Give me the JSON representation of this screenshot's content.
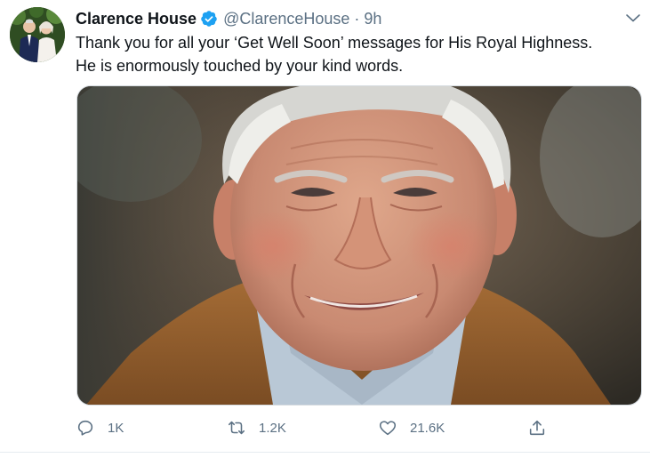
{
  "tweet": {
    "display_name": "Clarence House",
    "handle": "@ClarenceHouse",
    "separator": "·",
    "time": "9h",
    "text_lines": [
      "Thank you for all your ‘Get Well Soon’ messages for His Royal Highness.",
      "He is enormously touched by your kind words."
    ]
  },
  "actions": {
    "reply_count": "1K",
    "retweet_count": "1.2K",
    "like_count": "21.6K"
  },
  "colors": {
    "verified": "#1da1f2",
    "secondary_text": "#5b7083"
  },
  "icons": {
    "verified": "verified-badge-icon",
    "more": "chevron-down-icon",
    "reply": "reply-icon",
    "retweet": "retweet-icon",
    "like": "heart-icon",
    "share": "share-icon"
  }
}
